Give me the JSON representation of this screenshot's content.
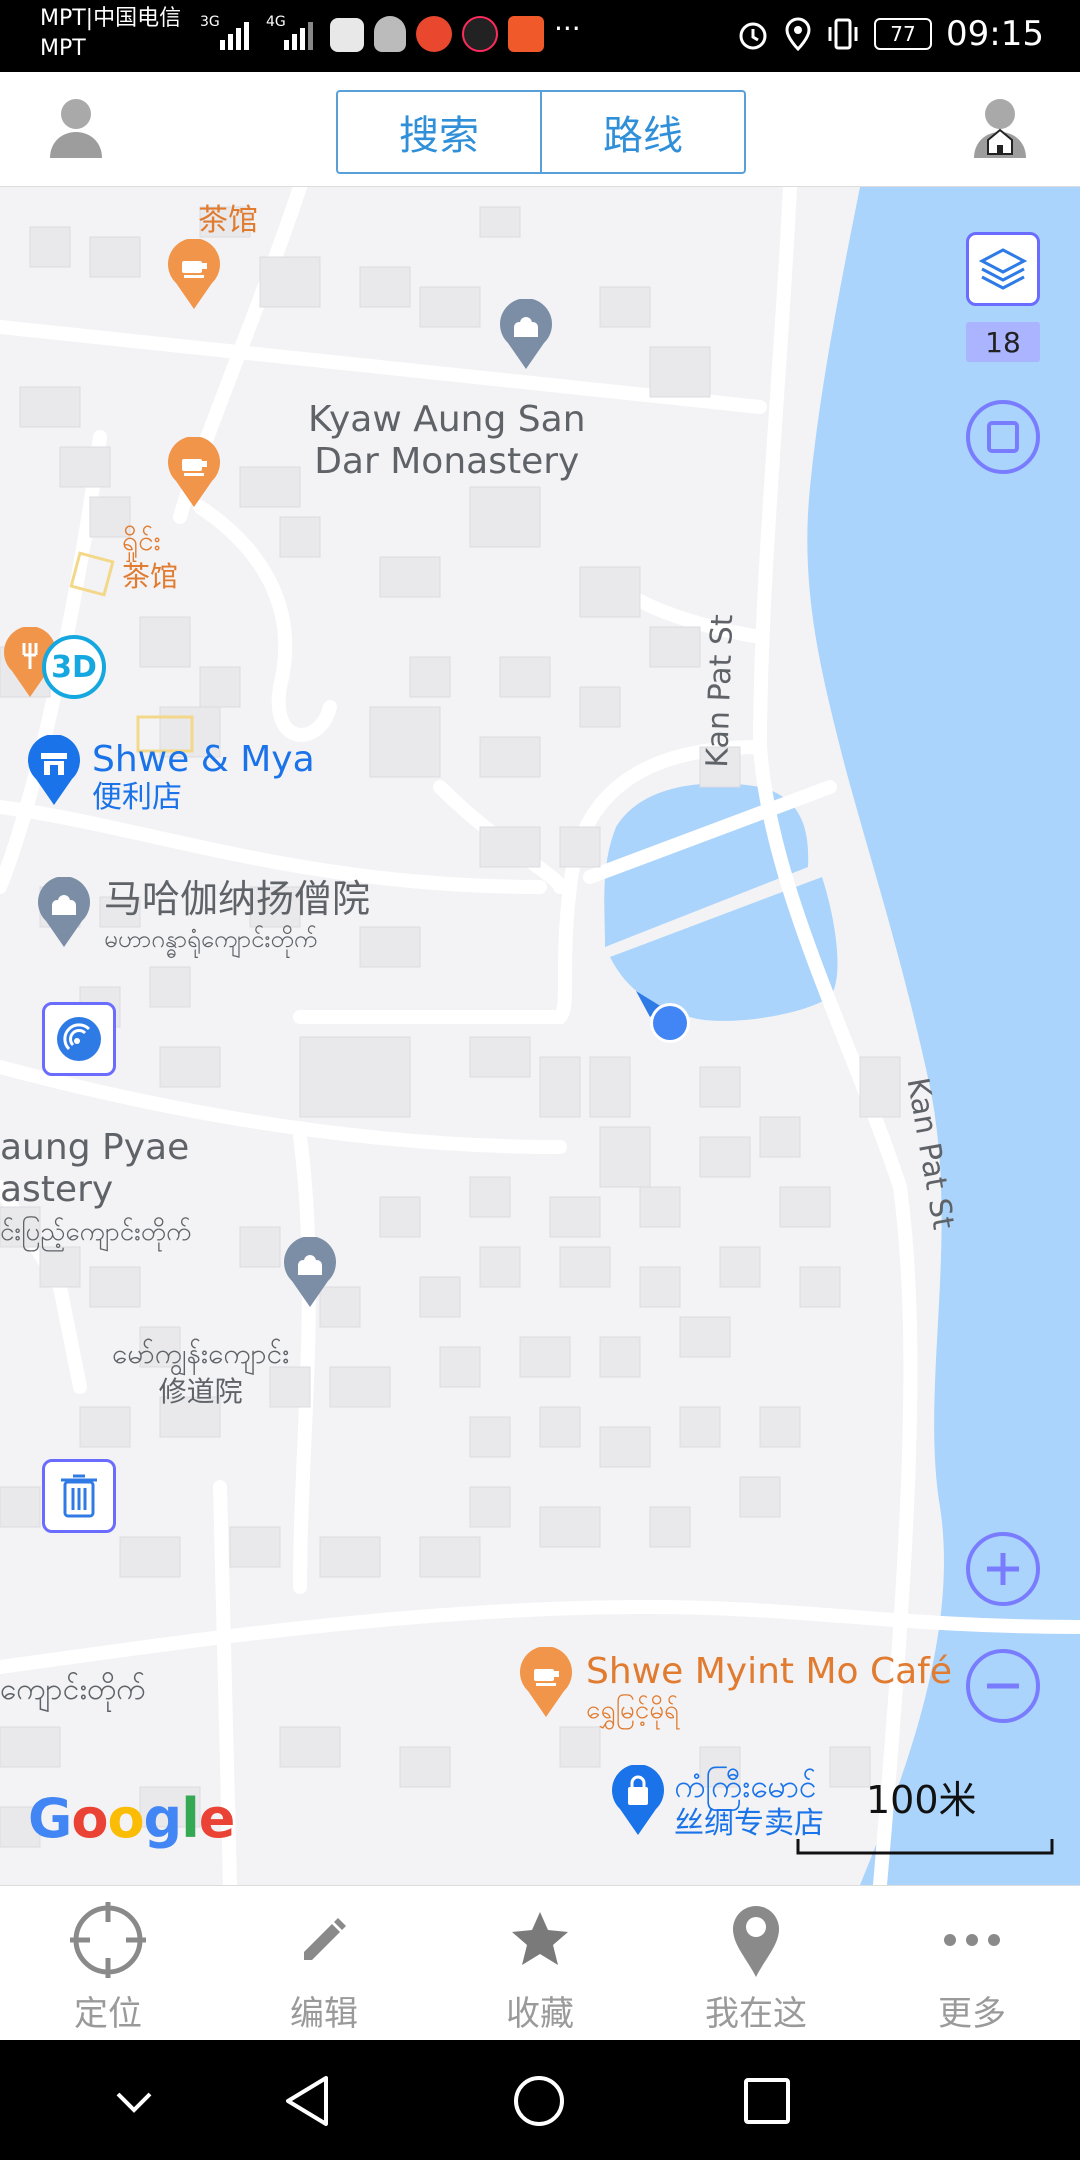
{
  "status_bar": {
    "carrier_line1": "MPT|中国电信",
    "carrier_line2": "MPT",
    "network_1": "3G",
    "network_2": "4G",
    "more": "···",
    "battery": "77",
    "time": "09:15"
  },
  "header": {
    "tabs": [
      "搜索",
      "路线"
    ]
  },
  "map": {
    "zoom_level": "18",
    "scale_label": "100米",
    "google_logo": "Google",
    "labels": {
      "teahouse_top": "茶馆",
      "monastery_en_1": "Kyaw Aung San",
      "monastery_en_2": "Dar Monastery",
      "teahouse_mm": "ရှိုင်း",
      "teahouse_cn": "茶馆",
      "shop_en": "Shwe & Mya",
      "shop_cn": "便利店",
      "maha_cn": "马哈伽纳扬僧院",
      "maha_mm": "မဟာဂန္ဓာရုံကျောင်းတိုက်",
      "pyae_en_1": "aung Pyae",
      "pyae_en_2": "astery",
      "pyae_mm": "င်းပြည့်ကျောင်းတိုက်",
      "convent_mm": "မော်ကျွန်းကျောင်း",
      "convent_cn": "修道院",
      "kanpat_1": "Kan Pat St",
      "kanpat_2": "Kan Pat St",
      "cafe_en": "Shwe Myint Mo Café",
      "cafe_mm": "ရွှေမြင့်မိုရ်",
      "silk_mm": "ကံကြီးမောင်",
      "silk_cn": "丝绸专卖店",
      "bottom_left_mm": "ကျောင်းတိုက်",
      "three_d": "3D"
    }
  },
  "bottom_nav": {
    "items": [
      {
        "label": "定位",
        "icon": "locate-icon"
      },
      {
        "label": "编辑",
        "icon": "pencil-icon"
      },
      {
        "label": "收藏",
        "icon": "star-icon"
      },
      {
        "label": "我在这",
        "icon": "pin-icon"
      },
      {
        "label": "更多",
        "icon": "more-icon"
      }
    ]
  },
  "colors": {
    "water": "#aad4fb",
    "accent": "#7a7cff",
    "tab_blue": "#2f8fd8"
  }
}
